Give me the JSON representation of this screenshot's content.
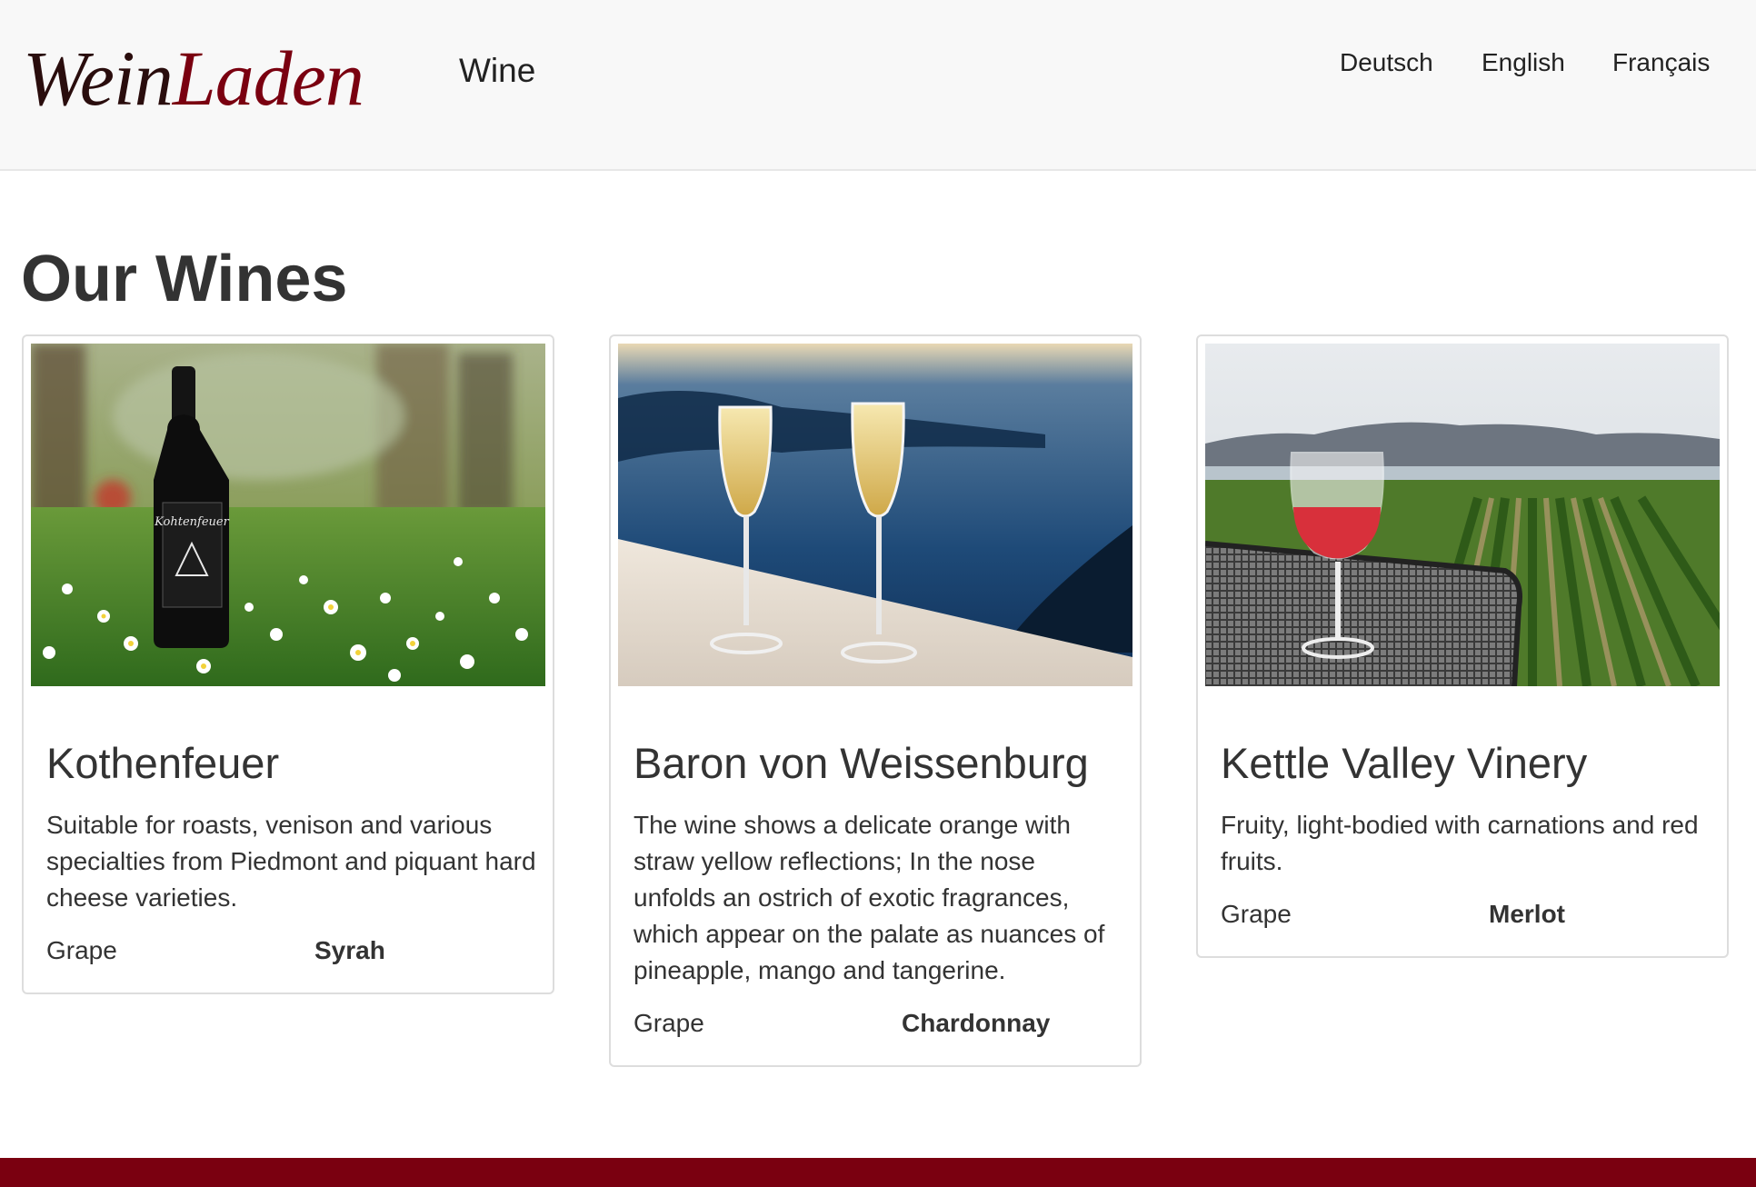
{
  "header": {
    "logo_part1": "Wein",
    "logo_part2": "Laden",
    "nav_wine": "Wine",
    "languages": [
      "Deutsch",
      "English",
      "Français"
    ]
  },
  "main": {
    "title": "Our Wines",
    "wines": [
      {
        "name": "Kothenfeuer",
        "description": "Suitable for roasts, venison and various specialties from Piedmont and piquant hard cheese varieties.",
        "grape_label": "Grape",
        "grape": "Syrah",
        "label_text": "Kohtenfeuer"
      },
      {
        "name": "Baron von Weissenburg",
        "description": "The wine shows a delicate orange with straw yellow reflections; In the nose unfolds an ostrich of exotic fragrances, which appear on the palate as nuances of pineapple, mango and tangerine.",
        "grape_label": "Grape",
        "grape": "Chardonnay"
      },
      {
        "name": "Kettle Valley Vinery",
        "description": "Fruity, light-bodied with carnations and red fruits.",
        "grape_label": "Grape",
        "grape": "Merlot"
      }
    ]
  },
  "colors": {
    "brand": "#7a0010",
    "navbar_bg": "#f8f8f8",
    "text": "#333333"
  }
}
